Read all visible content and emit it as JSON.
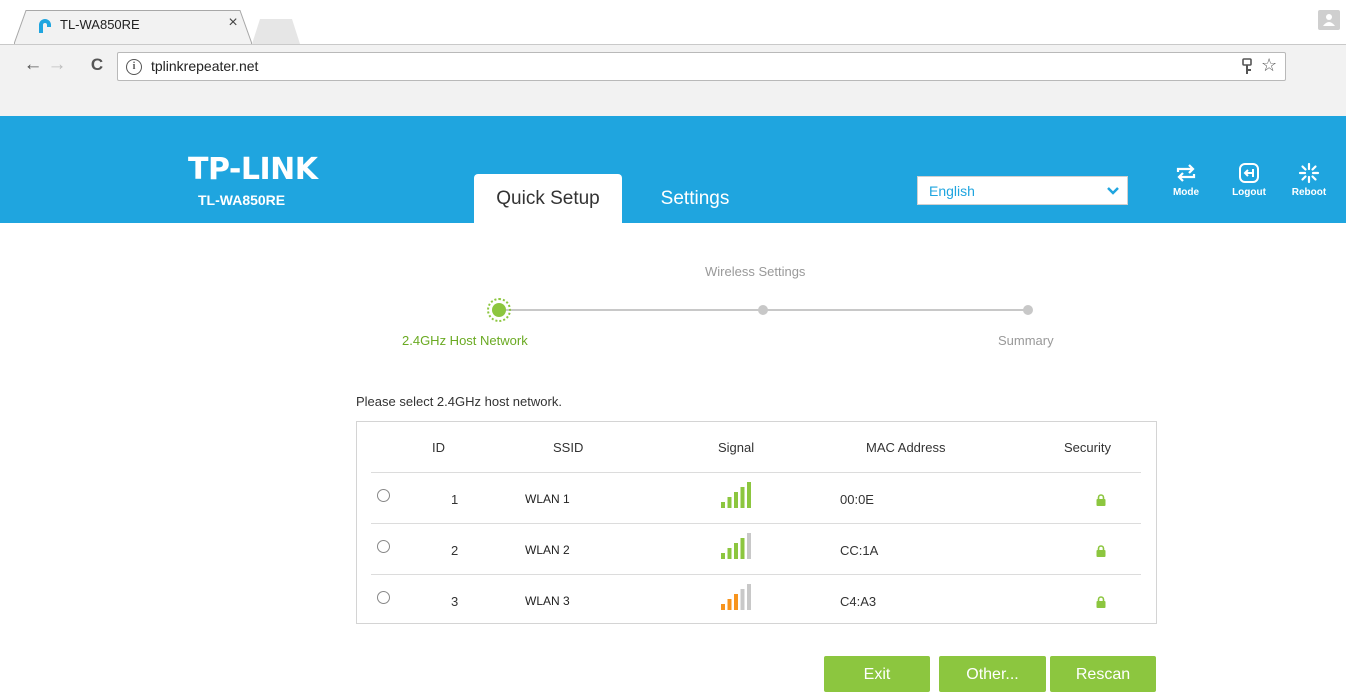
{
  "browser": {
    "tab_title": "TL-WA850RE",
    "tab_close": "×",
    "url": "tplinkrepeater.net",
    "back": "←",
    "forward": "→",
    "reload": "C",
    "info": "i",
    "bookmark": "☆"
  },
  "header": {
    "logo": "TP-LINK",
    "model": "TL-WA850RE",
    "nav": [
      "Quick Setup",
      "Settings"
    ],
    "language": "English",
    "icons": [
      {
        "icon": "mode-icon",
        "label": "Mode"
      },
      {
        "icon": "logout-icon",
        "label": "Logout"
      },
      {
        "icon": "reboot-icon",
        "label": "Reboot"
      }
    ],
    "brand_color": "#1fa5df"
  },
  "progress": {
    "title": "Wireless Settings",
    "steps": [
      "2.4GHz Host Network",
      "Summary"
    ],
    "active_color": "#8cc63f"
  },
  "scan": {
    "prompt": "Please select 2.4GHz host network.",
    "columns": [
      "ID",
      "SSID",
      "Signal",
      "MAC Address",
      "Security"
    ],
    "rows": [
      {
        "id": "1",
        "ssid": "WLAN 1",
        "signal_bars": 5,
        "signal_color": "#8cc63f",
        "mac": "00:0E",
        "security": "lock-icon"
      },
      {
        "id": "2",
        "ssid": "WLAN 2",
        "signal_bars": 4,
        "signal_color": "#8cc63f",
        "mac": "CC:1A",
        "security": "lock-icon"
      },
      {
        "id": "3",
        "ssid": "WLAN 3",
        "signal_bars": 3,
        "signal_color": "#f7941d",
        "mac": "C4:A3",
        "security": "lock-icon"
      }
    ]
  },
  "buttons": {
    "exit": "Exit",
    "other": "Other...",
    "rescan": "Rescan"
  }
}
